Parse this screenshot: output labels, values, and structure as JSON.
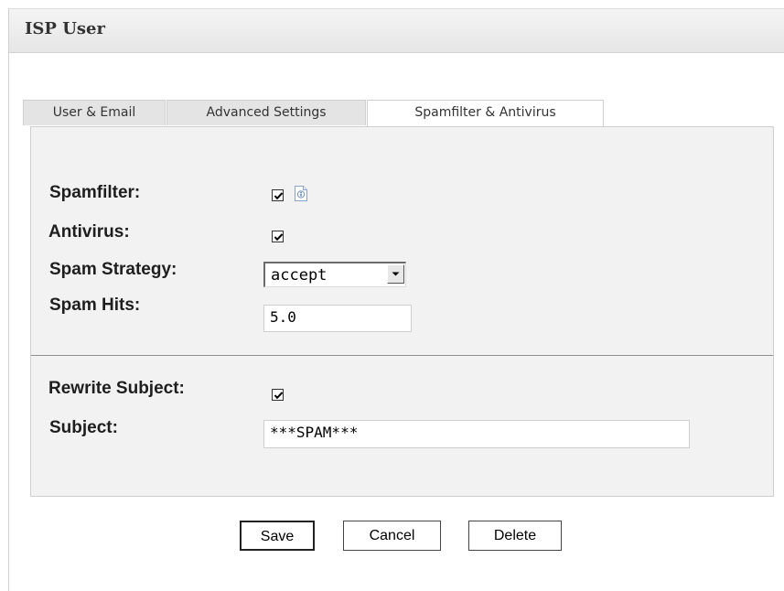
{
  "window": {
    "title": "ISP User"
  },
  "tabs": [
    {
      "label": "User & Email",
      "active": false
    },
    {
      "label": "Advanced Settings",
      "active": false
    },
    {
      "label": "Spamfilter & Antivirus",
      "active": true
    }
  ],
  "form": {
    "spamfilter": {
      "label": "Spamfilter:",
      "checked": true,
      "help_icon": "info-icon"
    },
    "antivirus": {
      "label": "Antivirus:",
      "checked": true
    },
    "spam_strategy": {
      "label": "Spam Strategy:",
      "value": "accept"
    },
    "spam_hits": {
      "label": "Spam Hits:",
      "value": "5.0"
    },
    "rewrite_subject": {
      "label": "Rewrite Subject:",
      "checked": true
    },
    "subject": {
      "label": "Subject:",
      "value": "***SPAM***"
    }
  },
  "buttons": {
    "save": "Save",
    "cancel": "Cancel",
    "delete": "Delete"
  }
}
